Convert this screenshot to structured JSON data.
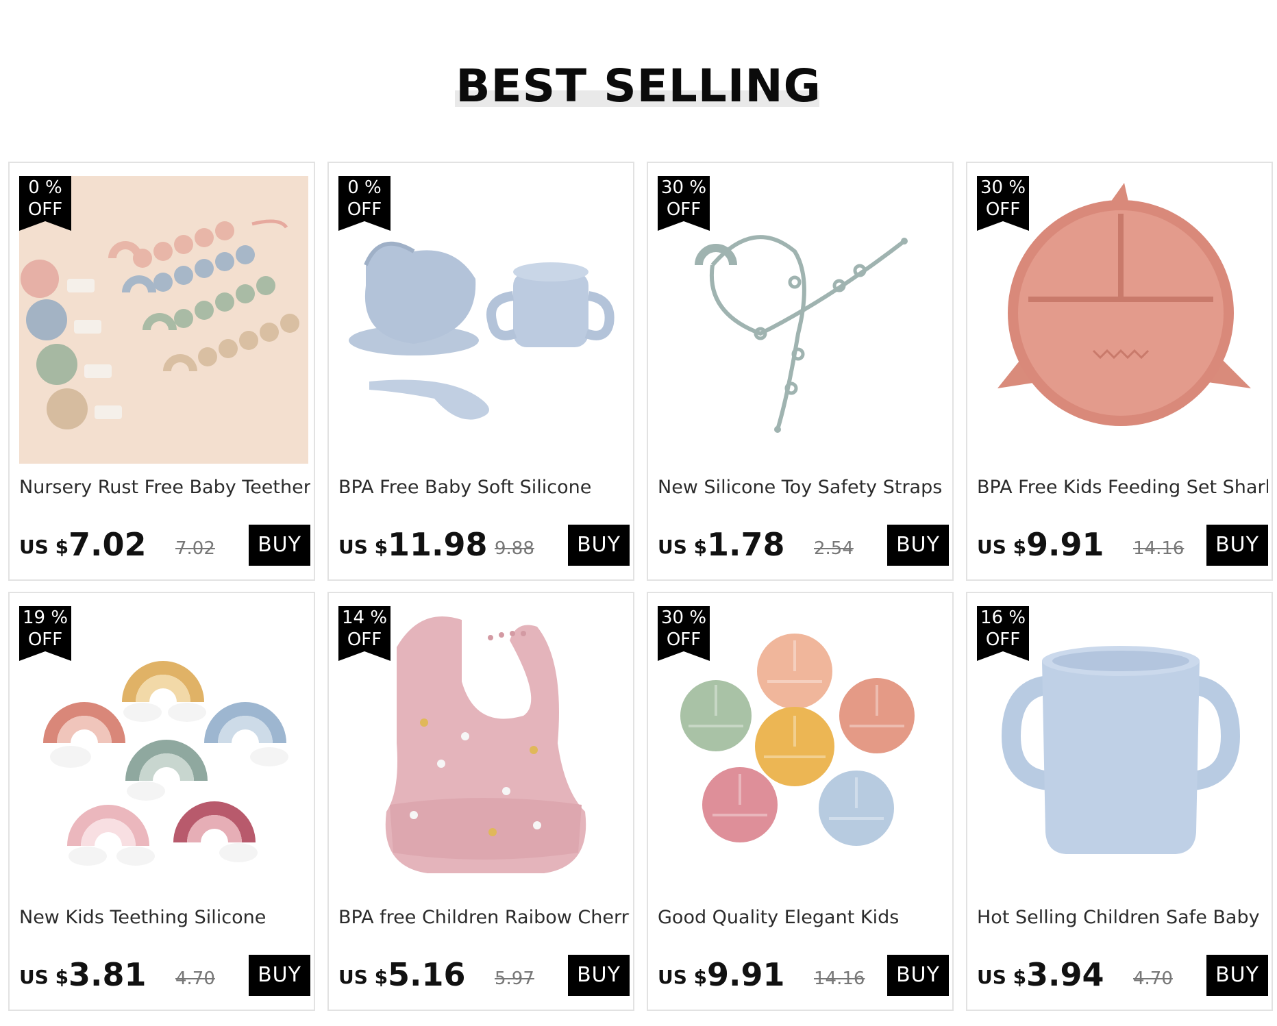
{
  "section": {
    "title": "BEST SELLING"
  },
  "products": [
    {
      "discount_pct": "0  %",
      "discount_off": "OFF",
      "name": "Nursery Rust Free Baby Teether",
      "currency": "US $",
      "price": "7.02",
      "old_price": "7.02",
      "buy_label": "BUY",
      "image": "pacifier-clips-icon"
    },
    {
      "discount_pct": "0  %",
      "discount_off": "OFF",
      "name": "BPA Free Baby Soft Silicone",
      "currency": "US $",
      "price": "11.98",
      "old_price": "9.88",
      "buy_label": "BUY",
      "image": "bowl-cup-spoon-icon"
    },
    {
      "discount_pct": "30  %",
      "discount_off": "OFF",
      "name": "New Silicone Toy Safety Straps",
      "currency": "US $",
      "price": "1.78",
      "old_price": "2.54",
      "buy_label": "BUY",
      "image": "toy-strap-icon"
    },
    {
      "discount_pct": "30  %",
      "discount_off": "OFF",
      "name": "BPA Free Kids Feeding Set Shark",
      "currency": "US $",
      "price": "9.91",
      "old_price": "14.16",
      "buy_label": "BUY",
      "image": "shark-plate-icon"
    },
    {
      "discount_pct": "19  %",
      "discount_off": "OFF",
      "name": "New Kids Teething Silicone",
      "currency": "US $",
      "price": "3.81",
      "old_price": "4.70",
      "buy_label": "BUY",
      "image": "rainbow-teethers-icon"
    },
    {
      "discount_pct": "14  %",
      "discount_off": "OFF",
      "name": "BPA free Children Raibow Cherry",
      "currency": "US $",
      "price": "5.16",
      "old_price": "5.97",
      "buy_label": "BUY",
      "image": "pink-bib-icon"
    },
    {
      "discount_pct": "30  %",
      "discount_off": "OFF",
      "name": "Good Quality Elegant Kids",
      "currency": "US $",
      "price": "9.91",
      "old_price": "14.16",
      "buy_label": "BUY",
      "image": "animal-plates-icon"
    },
    {
      "discount_pct": "16  %",
      "discount_off": "OFF",
      "name": "Hot Selling Children Safe Baby",
      "currency": "US $",
      "price": "3.94",
      "old_price": "4.70",
      "buy_label": "BUY",
      "image": "blue-cup-icon"
    }
  ]
}
